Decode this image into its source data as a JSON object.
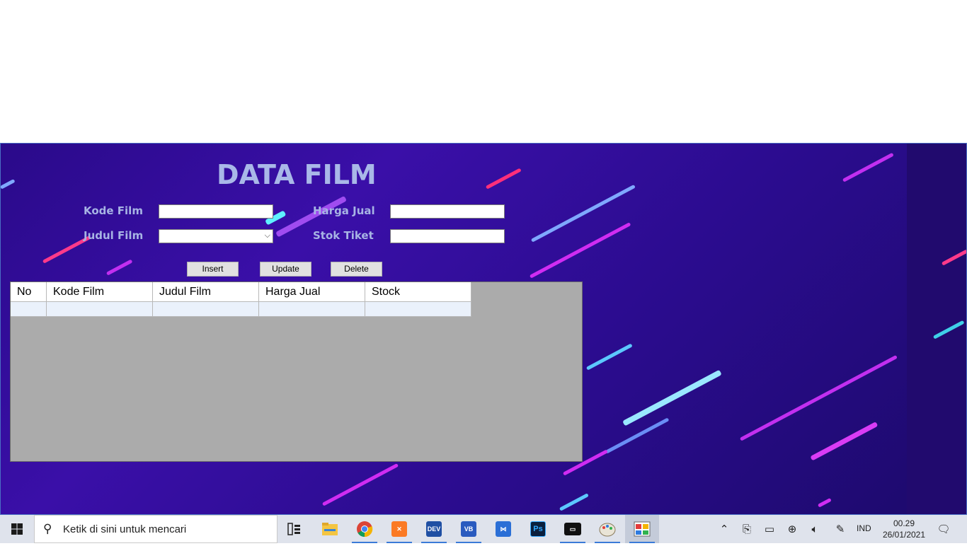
{
  "form": {
    "title": "DATA FILM",
    "labels": {
      "kode_film": "Kode Film",
      "judul_film": "Judul Film",
      "harga_jual": "Harga Jual",
      "stok_tiket": "Stok Tiket"
    },
    "values": {
      "kode_film": "",
      "judul_film": "",
      "harga_jual": "",
      "stok_tiket": ""
    },
    "buttons": {
      "insert": "Insert",
      "update": "Update",
      "delete": "Delete"
    },
    "grid": {
      "columns": [
        "No",
        "Kode Film",
        "Judul Film",
        "Harga Jual",
        "Stock"
      ],
      "rows": []
    }
  },
  "taskbar": {
    "search_placeholder": "Ketik di sini untuk mencari",
    "apps": [
      {
        "icon": "task-view-icon"
      },
      {
        "icon": "file-explorer-icon"
      },
      {
        "icon": "chrome-icon"
      },
      {
        "icon": "xampp-icon"
      },
      {
        "icon": "devcpp-icon",
        "label": "DEV"
      },
      {
        "icon": "visual-basic-icon",
        "label": "VB"
      },
      {
        "icon": "visual-studio-installer-icon"
      },
      {
        "icon": "photoshop-icon",
        "label": "Ps"
      },
      {
        "icon": "command-prompt-icon"
      },
      {
        "icon": "paint-icon"
      },
      {
        "icon": "running-form-app-icon"
      }
    ],
    "language": "IND",
    "time": "00.29",
    "date": "26/01/2021"
  },
  "colors": {
    "form_background": "#2a0a8a",
    "label_color": "#a7b4e4",
    "grid_background": "#ababab",
    "taskbar": "#dfe3ec"
  }
}
